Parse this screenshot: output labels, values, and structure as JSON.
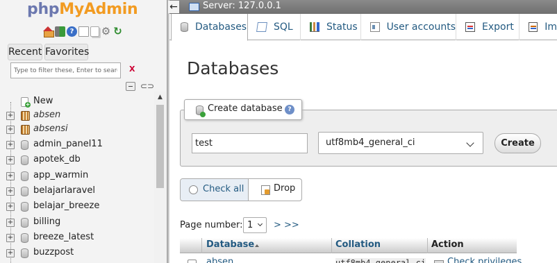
{
  "nav": {
    "logo_php": "php",
    "logo_myadmin": "MyAdmin",
    "tabs": {
      "recent": "Recent",
      "favorites": "Favorites"
    },
    "filter_placeholder": "Type to filter these, Enter to search all",
    "filter_clear": "X",
    "tree_new": "New",
    "databases": [
      "absen",
      "absensi",
      "admin_panel11",
      "apotek_db",
      "app_warmin",
      "belajarlaravel",
      "belajar_breeze",
      "billing",
      "breeze_latest",
      "buzzpost"
    ]
  },
  "topbar": {
    "back": "←",
    "server_label": "Server: 127.0.0.1"
  },
  "tabs": [
    {
      "label": "Databases",
      "icon": "database-icon"
    },
    {
      "label": "SQL",
      "icon": "sql-icon"
    },
    {
      "label": "Status",
      "icon": "status-icon"
    },
    {
      "label": "User accounts",
      "icon": "users-icon"
    },
    {
      "label": "Export",
      "icon": "export-icon"
    },
    {
      "label": "Im",
      "icon": "import-icon"
    }
  ],
  "main": {
    "title": "Databases",
    "create": {
      "legend": "Create database",
      "name_value": "test",
      "collation_value": "utf8mb4_general_ci",
      "create_button": "Create"
    },
    "actions": {
      "check_all": "Check all",
      "drop": "Drop"
    },
    "pagination": {
      "label": "Page number:",
      "current": "1",
      "next": "> >>"
    },
    "table": {
      "headers": {
        "database": "Database",
        "collation": "Collation",
        "action": "Action"
      },
      "rows": [
        {
          "name": "absen",
          "collation": "utf8mb4_general_ci",
          "action": "Check privileges"
        }
      ]
    }
  }
}
